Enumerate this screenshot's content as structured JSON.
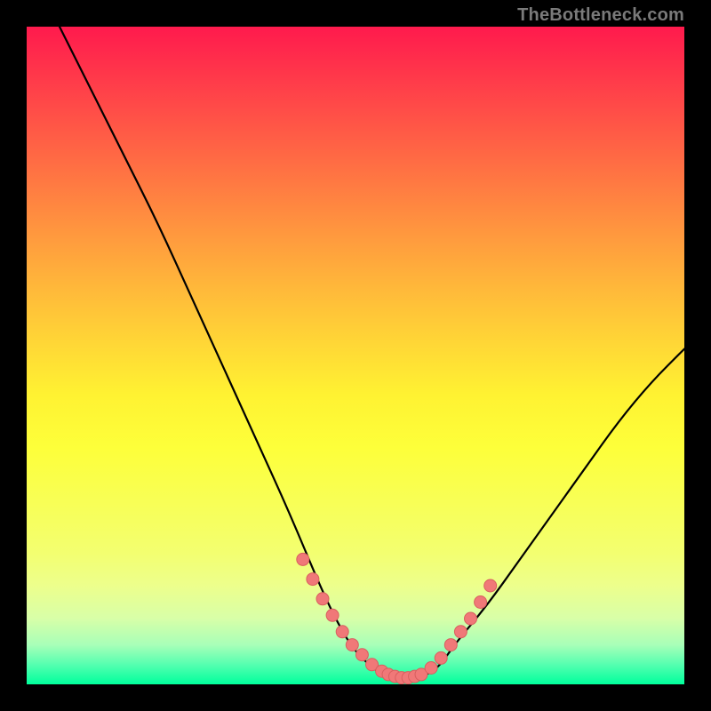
{
  "watermark": {
    "text": "TheBottleneck.com"
  },
  "chart_data": {
    "type": "line",
    "title": "",
    "xlabel": "",
    "ylabel": "",
    "xlim": [
      0,
      100
    ],
    "ylim": [
      0,
      100
    ],
    "series": [
      {
        "name": "bottleneck-curve",
        "x": [
          5,
          10,
          15,
          20,
          25,
          30,
          35,
          40,
          45,
          48,
          50,
          52,
          54,
          55,
          57,
          59,
          61,
          63,
          65,
          70,
          75,
          80,
          85,
          90,
          95,
          100
        ],
        "values": [
          100,
          90,
          80,
          70,
          59,
          48,
          37,
          26,
          14,
          8,
          5,
          3,
          1.5,
          1,
          1,
          1,
          1.5,
          3,
          6,
          12,
          19,
          26,
          33,
          40,
          46,
          51
        ]
      }
    ],
    "highlight_points": {
      "name": "optimal-range-dots",
      "x": [
        42,
        43.5,
        45,
        46.5,
        48,
        49.5,
        51,
        52.5,
        54,
        55,
        56,
        57,
        58,
        59,
        60,
        61.5,
        63,
        64.5,
        66,
        67.5,
        69,
        70.5
      ],
      "values": [
        19,
        16,
        13,
        10.5,
        8,
        6,
        4.5,
        3,
        2,
        1.5,
        1.2,
        1,
        1,
        1.2,
        1.5,
        2.5,
        4,
        6,
        8,
        10,
        12.5,
        15
      ]
    },
    "colors": {
      "curve": "#000000",
      "dot_fill": "#f07878",
      "dot_stroke": "#d85f5f"
    }
  }
}
